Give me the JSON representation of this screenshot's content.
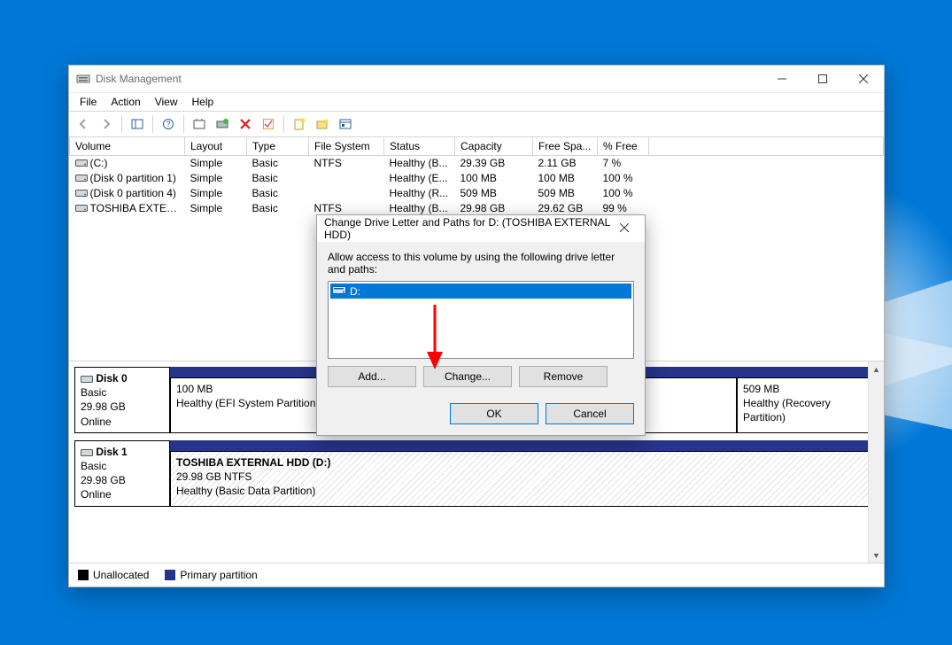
{
  "app": {
    "title": "Disk Management"
  },
  "menu": {
    "file": "File",
    "action": "Action",
    "view": "View",
    "help": "Help"
  },
  "columns": {
    "volume": "Volume",
    "layout": "Layout",
    "type": "Type",
    "filesystem": "File System",
    "status": "Status",
    "capacity": "Capacity",
    "freespace": "Free Spa...",
    "pctfree": "% Free"
  },
  "volumes": [
    {
      "volume": "(C:)",
      "layout": "Simple",
      "type": "Basic",
      "fs": "NTFS",
      "status": "Healthy (B...",
      "capacity": "29.39 GB",
      "free": "2.11 GB",
      "pct": "7 %"
    },
    {
      "volume": "(Disk 0 partition 1)",
      "layout": "Simple",
      "type": "Basic",
      "fs": "",
      "status": "Healthy (E...",
      "capacity": "100 MB",
      "free": "100 MB",
      "pct": "100 %"
    },
    {
      "volume": "(Disk 0 partition 4)",
      "layout": "Simple",
      "type": "Basic",
      "fs": "",
      "status": "Healthy (R...",
      "capacity": "509 MB",
      "free": "509 MB",
      "pct": "100 %"
    },
    {
      "volume": "TOSHIBA EXTERN...",
      "layout": "Simple",
      "type": "Basic",
      "fs": "NTFS",
      "status": "Healthy (B...",
      "capacity": "29.98 GB",
      "free": "29.62 GB",
      "pct": "99 %"
    }
  ],
  "disks": [
    {
      "name": "Disk 0",
      "type": "Basic",
      "size": "29.98 GB",
      "status": "Online",
      "segments": [
        {
          "title": "",
          "size": "100 MB",
          "detail": "Healthy (EFI System Partition",
          "width": "24%",
          "hatched": false
        },
        {
          "title": "",
          "size": "",
          "detail": "",
          "width": "56%",
          "hatched": false
        },
        {
          "title": "",
          "size": "509 MB",
          "detail": "Healthy (Recovery Partition)",
          "width": "20%",
          "hatched": false
        }
      ]
    },
    {
      "name": "Disk 1",
      "type": "Basic",
      "size": "29.98 GB",
      "status": "Online",
      "segments": [
        {
          "title": "TOSHIBA EXTERNAL HDD  (D:)",
          "size": "29.98 GB NTFS",
          "detail": "Healthy (Basic Data Partition)",
          "width": "100%",
          "hatched": true
        }
      ]
    }
  ],
  "legend": {
    "unallocated": "Unallocated",
    "primary": "Primary partition"
  },
  "dialog": {
    "title": "Change Drive Letter and Paths for D: (TOSHIBA EXTERNAL HDD)",
    "instruction": "Allow access to this volume by using the following drive letter and paths:",
    "selected": "D:",
    "buttons": {
      "add": "Add...",
      "change": "Change...",
      "remove": "Remove",
      "ok": "OK",
      "cancel": "Cancel"
    }
  }
}
